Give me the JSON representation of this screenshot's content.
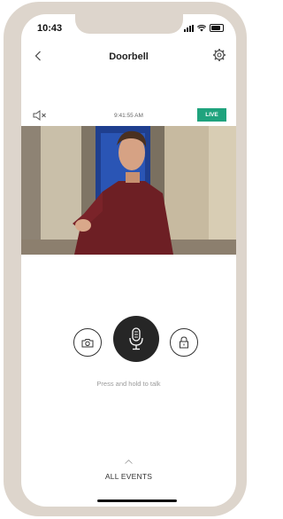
{
  "status": {
    "time": "10:43"
  },
  "header": {
    "title": "Doorbell"
  },
  "camera": {
    "timestamp": "9:41:55 AM",
    "live_label": "LIVE"
  },
  "talk": {
    "hint": "Press and hold to talk"
  },
  "footer": {
    "all_events_label": "ALL EVENTS"
  },
  "colors": {
    "frame": "#ddd5cc",
    "live_badge": "#1fa37d",
    "mic_button": "#262626"
  },
  "icons": [
    "chevron-left-icon",
    "gear-icon",
    "speaker-muted-icon",
    "camera-icon",
    "microphone-icon",
    "lock-icon",
    "chevron-up-icon"
  ]
}
